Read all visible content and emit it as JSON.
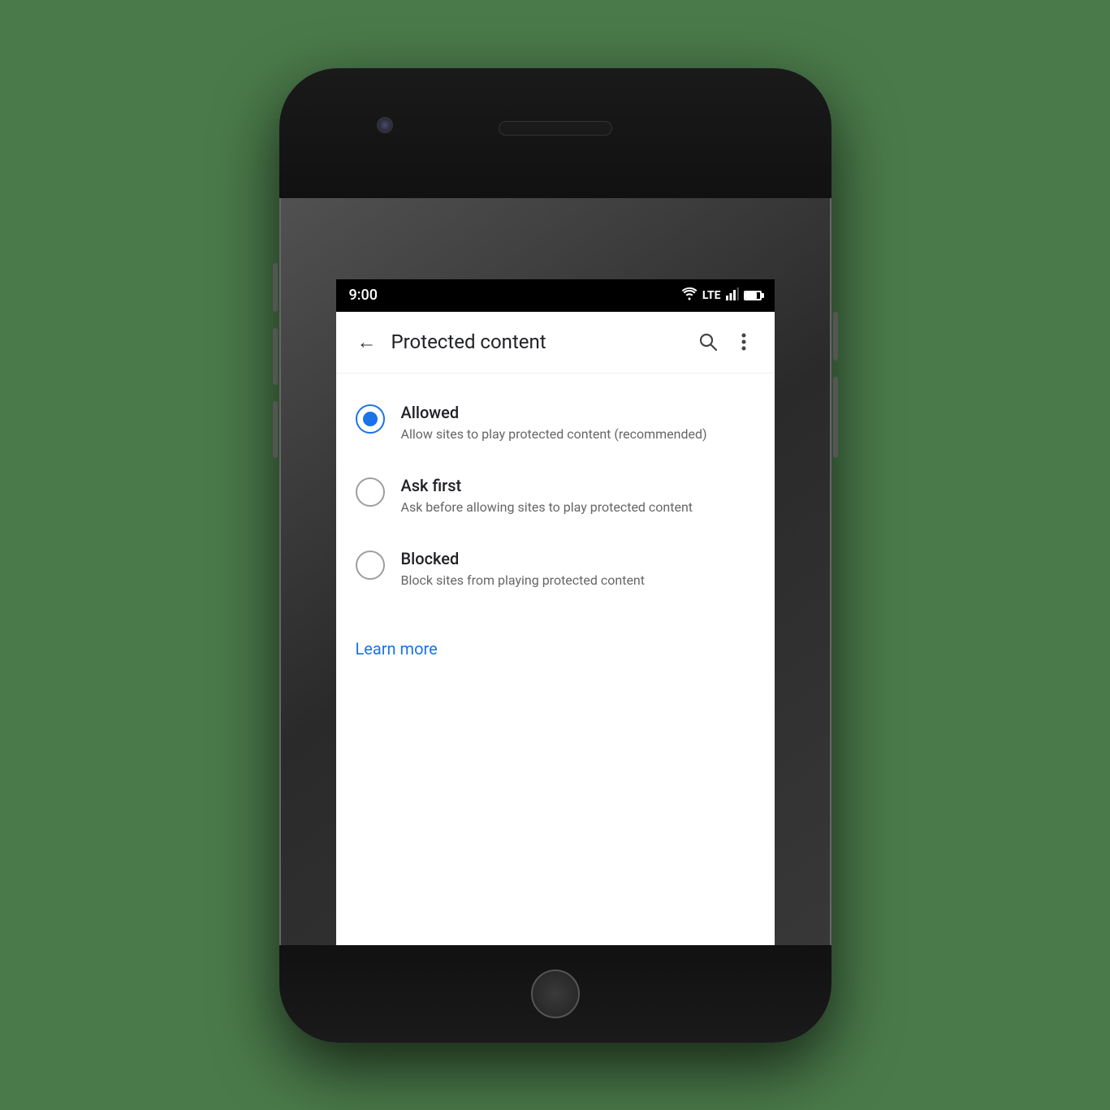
{
  "status_bar": {
    "time": "9:00",
    "lte_label": "LTE"
  },
  "app_bar": {
    "title": "Protected content",
    "back_label": "←",
    "search_label": "search",
    "more_label": "more"
  },
  "radio_options": [
    {
      "id": "allowed",
      "label": "Allowed",
      "description": "Allow sites to play protected content (recommended)",
      "selected": true
    },
    {
      "id": "ask-first",
      "label": "Ask first",
      "description": "Ask before allowing sites to play protected content",
      "selected": false
    },
    {
      "id": "blocked",
      "label": "Blocked",
      "description": "Block sites from playing protected content",
      "selected": false
    }
  ],
  "learn_more": {
    "label": "Learn more"
  }
}
